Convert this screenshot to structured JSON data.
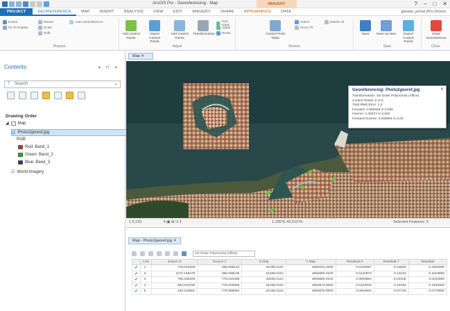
{
  "window": {
    "title": "ArcGIS Pro - Georeferencing - Map",
    "context_tab": "IMAGERY",
    "controls": [
      "?",
      "–",
      "□",
      "✕"
    ]
  },
  "ribbon": {
    "tabs": [
      "PROJECT",
      "GEOREFERENCE",
      "MAP",
      "INSERT",
      "ANALYSIS",
      "VIEW",
      "EDIT",
      "IMAGERY",
      "SHARE",
      "APPEARANCE",
      "DATA"
    ],
    "signin": "gisuser_portal (Pro Demo)",
    "prepare": {
      "label": "Prepare",
      "items": [
        "Extent",
        "Fit To Display",
        "Rotate",
        "Scale",
        "Shift",
        "Auto Georeference"
      ]
    },
    "adjust": {
      "label": "Adjust",
      "big": [
        "Add Control Points",
        "Import Control Points",
        "Add Control Points",
        "Transformation"
      ],
      "small": [
        "Auto Apply",
        "Apply",
        "Reset"
      ]
    },
    "review": {
      "label": "Review",
      "big": [
        "Control Point Table"
      ],
      "small": [
        "Select",
        "Zoom To",
        "Delete All"
      ]
    },
    "save": {
      "label": "Save",
      "big": [
        "Save",
        "Save as New",
        "Export Control Points"
      ]
    },
    "close": {
      "label": "Close",
      "big": [
        "Close Georeference"
      ]
    }
  },
  "contents": {
    "title": "Contents",
    "controls": "▾ ⊓ ✕",
    "search_placeholder": "Search",
    "drawing_order": "Drawing Order",
    "map": "Map",
    "layer": "Photo2georef.jpg",
    "rgb": "RGB",
    "bands": [
      {
        "label": "Red: Band_1",
        "color": "#e02020"
      },
      {
        "label": "Green: Band_2",
        "color": "#18b818"
      },
      {
        "label": "Blue: Band_3",
        "color": "#1c2fd6"
      }
    ],
    "world": "World Imagery"
  },
  "map": {
    "tab": "Map",
    "popup": {
      "title": "Georeferencing: Photo2georef.jpg",
      "lines": [
        "Transformation: 1st Order Polynomial (Affine)",
        "Control Points: 6 of 6",
        "Total RMS Error: 1.3",
        "Forward: 0.000028 m 0.000",
        "Inverse: 3.40273 m 3.602",
        "Forward-Inverse: 0.000004 m 0.00"
      ]
    },
    "status": {
      "scale": "1:5,120",
      "coords": "1.235°E 43.512°N",
      "selected": "Selected Features: 0"
    }
  },
  "table": {
    "tab": "Map - Photo2georef.jpg",
    "transform_select": "1st Order Polynomial (Affine)",
    "columns": [
      "",
      "Link",
      "Source X",
      "Source Y",
      "X Map",
      "Y Map",
      "Residual X",
      "Residual Y",
      "Residual"
    ],
    "rows": [
      [
        "✔",
        "1",
        "775.010499",
        "-356.069122",
        "-41335.0110",
        "4894104.1000",
        "0.0125097",
        "-0.15026",
        "0.1503000"
      ],
      [
        "✔",
        "2",
        "1072.165478",
        "-356.096135",
        "-31335.0110",
        "4894080.0100",
        "0.0132876",
        "-0.16233",
        "0.1623600"
      ],
      [
        "✔",
        "3",
        "795.035320",
        "-775.010489",
        "-29335.0110",
        "4893680.0100",
        "0.0009584",
        "-0.02348",
        "0.0234900"
      ],
      [
        "✔",
        "4",
        "954.033780",
        "-775.003826",
        "-31335.0110",
        "4893673.0000",
        "0.0133040",
        "-0.15283",
        "0.1534000"
      ],
      [
        "✔",
        "5",
        "449.010581",
        "-778.965864",
        "-31335.0110",
        "4893679.0000",
        "0.0093564",
        "-0.07726",
        "0.0778000"
      ]
    ]
  }
}
